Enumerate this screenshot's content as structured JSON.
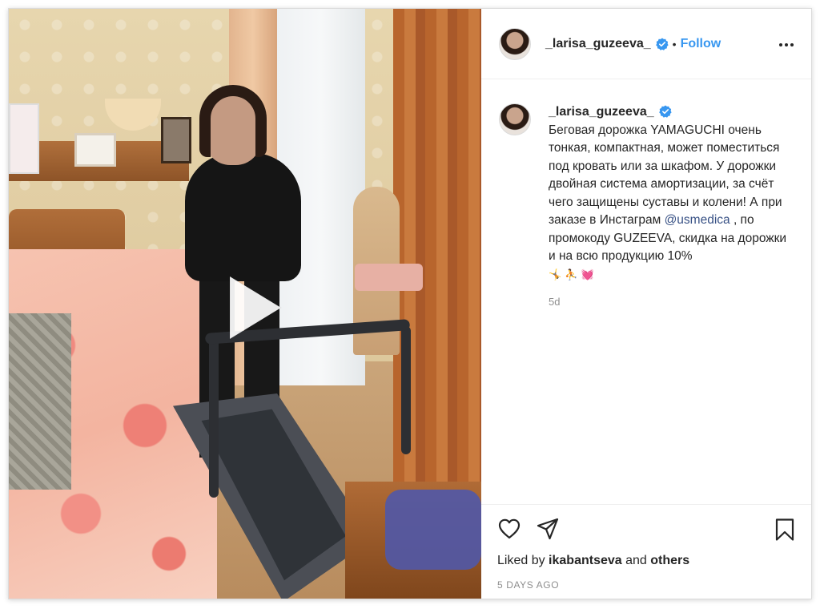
{
  "post": {
    "username": "_larisa_guzeeva_",
    "separator": "•",
    "follow_label": "Follow",
    "caption": {
      "username": "_larisa_guzeeva_",
      "text_part1": "Беговая дорожка YAMAGUCHI очень тонкая, компактная, может поместиться под кровать или за шкафом. У дорожки двойная система амортизации, за счёт чего защищены суставы и колени! А при заказе в Инстаграм ",
      "mention": "@usmedica",
      "text_part2": " , по промокоду GUZEEVA, скидка на дорожки и на всю продукцию 10%",
      "emojis": "🤸 ⛹ 💓"
    },
    "age": "5d",
    "likes": {
      "prefix": "Liked by ",
      "liker": "ikabantseva",
      "middle": " and ",
      "others": "others"
    },
    "timestamp": "5 DAYS AGO"
  },
  "colors": {
    "accent": "#3897f0",
    "verified": "#3897f0",
    "text": "#262626",
    "muted": "#8e8e8e"
  },
  "icons": {
    "more": "more-horizontal-icon",
    "like": "heart-icon",
    "share": "paper-plane-icon",
    "save": "bookmark-icon",
    "play": "play-icon",
    "verified": "verified-badge-icon"
  }
}
